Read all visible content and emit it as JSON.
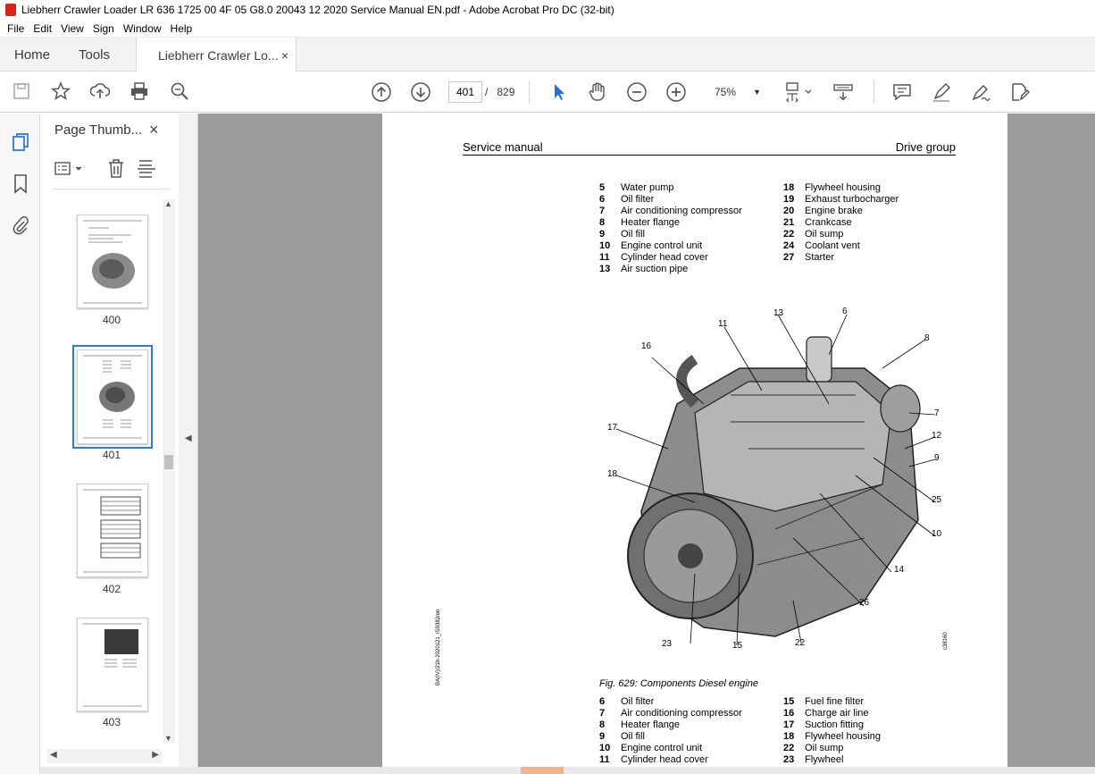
{
  "window": {
    "title": "Liebherr Crawler Loader LR 636 1725 00 4F 05 G8.0 20043 12 2020 Service Manual EN.pdf - Adobe Acrobat Pro DC (32-bit)"
  },
  "menu": [
    "File",
    "Edit",
    "View",
    "Sign",
    "Window",
    "Help"
  ],
  "tabs": {
    "home": "Home",
    "tools": "Tools",
    "document": "Liebherr Crawler Lo...",
    "close": "×"
  },
  "toolbar": {
    "current_page": "401",
    "page_separator": "/",
    "total_pages": "829",
    "zoom": "75%"
  },
  "thumbnail_panel": {
    "title": "Page Thumb...",
    "close": "×",
    "pages": [
      "400",
      "401",
      "402",
      "403"
    ],
    "selected": "401"
  },
  "page": {
    "header_left": "Service manual",
    "header_right": "Drive group",
    "legend_top_left": [
      {
        "n": "5",
        "t": "Water pump"
      },
      {
        "n": "6",
        "t": "Oil filter"
      },
      {
        "n": "7",
        "t": "Air conditioning compressor"
      },
      {
        "n": "8",
        "t": "Heater flange"
      },
      {
        "n": "9",
        "t": "Oil fill"
      },
      {
        "n": "10",
        "t": "Engine control unit"
      },
      {
        "n": "11",
        "t": "Cylinder head cover"
      },
      {
        "n": "13",
        "t": "Air suction pipe"
      }
    ],
    "legend_top_right": [
      {
        "n": "18",
        "t": "Flywheel housing"
      },
      {
        "n": "19",
        "t": "Exhaust turbocharger"
      },
      {
        "n": "20",
        "t": "Engine brake"
      },
      {
        "n": "21",
        "t": "Crankcase"
      },
      {
        "n": "22",
        "t": "Oil sump"
      },
      {
        "n": "24",
        "t": "Coolant vent"
      },
      {
        "n": "27",
        "t": "Starter"
      }
    ],
    "callouts": [
      "13",
      "6",
      "11",
      "8",
      "16",
      "7",
      "17",
      "12",
      "9",
      "18",
      "25",
      "10",
      "14",
      "26",
      "23",
      "15",
      "22"
    ],
    "image_id": "c38160",
    "caption": "Fig. 629: Components Diesel engine",
    "doc_id": "BA(IV)/21h-2020121_IS9382/en",
    "legend_bottom_left": [
      {
        "n": "6",
        "t": "Oil filter"
      },
      {
        "n": "7",
        "t": "Air conditioning compressor"
      },
      {
        "n": "8",
        "t": "Heater flange"
      },
      {
        "n": "9",
        "t": "Oil fill"
      },
      {
        "n": "10",
        "t": "Engine control unit"
      },
      {
        "n": "11",
        "t": "Cylinder head cover"
      }
    ],
    "legend_bottom_right": [
      {
        "n": "15",
        "t": "Fuel fine filter"
      },
      {
        "n": "16",
        "t": "Charge air line"
      },
      {
        "n": "17",
        "t": "Suction fitting"
      },
      {
        "n": "18",
        "t": "Flywheel housing"
      },
      {
        "n": "22",
        "t": "Oil sump"
      },
      {
        "n": "23",
        "t": "Flywheel"
      }
    ]
  },
  "colors": {
    "viewer_bg": "#9b9b9b",
    "selection": "#2c7cd6",
    "pdf_icon": "#d62518"
  }
}
